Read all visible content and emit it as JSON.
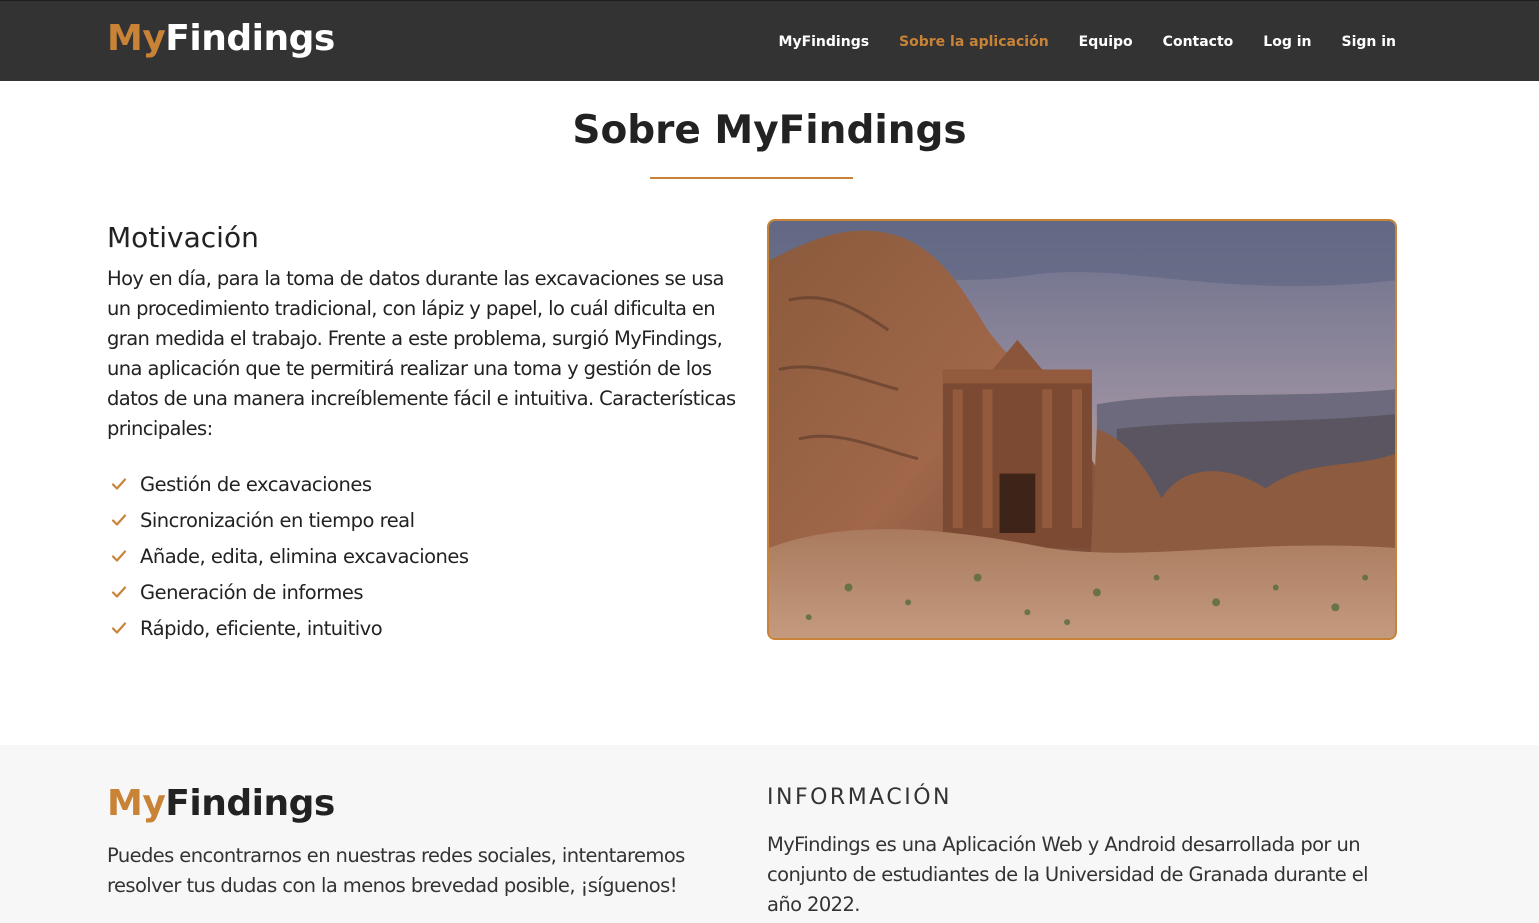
{
  "navbar": {
    "brand_prefix": "My",
    "brand_suffix": "Findings",
    "links": [
      {
        "label": "MyFindings"
      },
      {
        "label": "Sobre la aplicación"
      },
      {
        "label": "Equipo"
      },
      {
        "label": "Contacto"
      },
      {
        "label": "Log in"
      },
      {
        "label": "Sign in"
      }
    ],
    "active_index": 1
  },
  "page": {
    "title": "Sobre MyFindings"
  },
  "motivation": {
    "heading": "Motivación",
    "text": "Hoy en día, para la toma de datos durante las excavaciones se usa un procedimiento tradicional, con lápiz y papel, lo cuál dificulta en gran medida el trabajo. Frente a este problema, surgió MyFindings, una aplicación que te permitirá realizar una toma y gestión de los datos de una manera increíblemente fácil e intuitiva. Características principales:",
    "features": [
      "Gestión de excavaciones",
      "Sincronización en tiempo real",
      "Añade, edita, elimina excavaciones",
      "Generación de informes",
      "Rápido, eficiente, intuitivo"
    ],
    "feature_icon": "check-icon"
  },
  "hero_image": {
    "subject": "petra-monastery-photo"
  },
  "footer": {
    "brand_prefix": "My",
    "brand_suffix": "Findings",
    "left_text": "Puedes encontrarnos en nuestras redes sociales, intentaremos resolver tus dudas con la menos brevedad posible, ¡síguenos!",
    "info_heading": "INFORMACIÓN",
    "info_text": "MyFindings es una Aplicación Web y Android desarrollada por un conjunto de estudiantes de la Universidad de Granada durante el año 2022."
  },
  "colors": {
    "accent": "#c98337",
    "navbar_bg": "#333333",
    "footer_bg": "#f7f7f7"
  }
}
